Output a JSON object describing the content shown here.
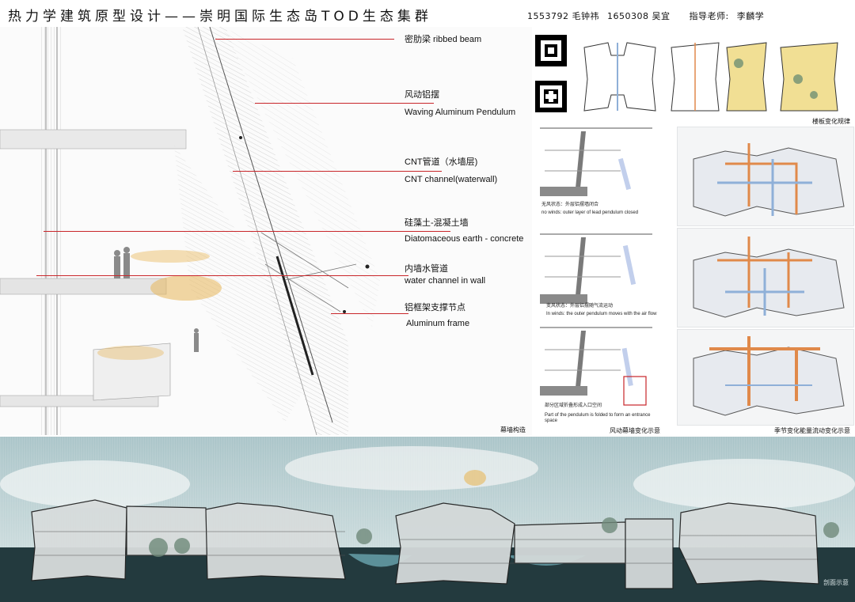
{
  "header": {
    "title": "热力学建筑原型设计——崇明国际生态岛TOD生态集群",
    "student1": "1553792 毛钟祎",
    "student2": "1650308 吴宜",
    "advisor_label": "指导老师:",
    "advisor": "李麟学"
  },
  "annotations": [
    {
      "id": "ribbed-beam",
      "lines": [
        "密肋梁 ribbed beam"
      ]
    },
    {
      "id": "pendulum",
      "lines": [
        "风动铝摆",
        "Waving Aluminum Pendulum"
      ]
    },
    {
      "id": "cnt",
      "lines": [
        "CNT管道（水墙层)",
        "CNT channel(waterwall)"
      ]
    },
    {
      "id": "diatom",
      "lines": [
        "硅藻土-混凝土墙",
        "Diatomaceous earth - concrete"
      ]
    },
    {
      "id": "water-channel",
      "lines": [
        "内墙水管道",
        "water channel in wall"
      ]
    },
    {
      "id": "aluminum-frame",
      "lines": [
        "铝框架支撑节点",
        "Aluminum frame"
      ]
    }
  ],
  "captions": {
    "curtain_wall": "幕墙构造",
    "wind_wall": "风动幕墙变化示意",
    "floor_change": "楼板变化规律",
    "seasonal": "季节变化能量流动变化示意",
    "section": "剖面示意"
  },
  "wind_states": [
    {
      "cn": "无风状态：外层铝摆墙闭合",
      "en": "no winds: outer layer of lead pendulum closed"
    },
    {
      "cn": "变风状态：外层铝摆随气流运动",
      "en": "In winds: the outer pendulum moves with the air flow"
    },
    {
      "cn": "部分区域折叠形成入口空间",
      "en": "Part of the pendulum is folded to form an entrance space"
    }
  ],
  "colors": {
    "accent_red": "#c8262a",
    "warm_orange": "#e0894a",
    "cool_blue": "#8fb0d8",
    "floor_yellow": "#f1df94",
    "foliage_gold": "#e8b75a",
    "water": "#233a3e",
    "sky": "#b9cfd4"
  }
}
